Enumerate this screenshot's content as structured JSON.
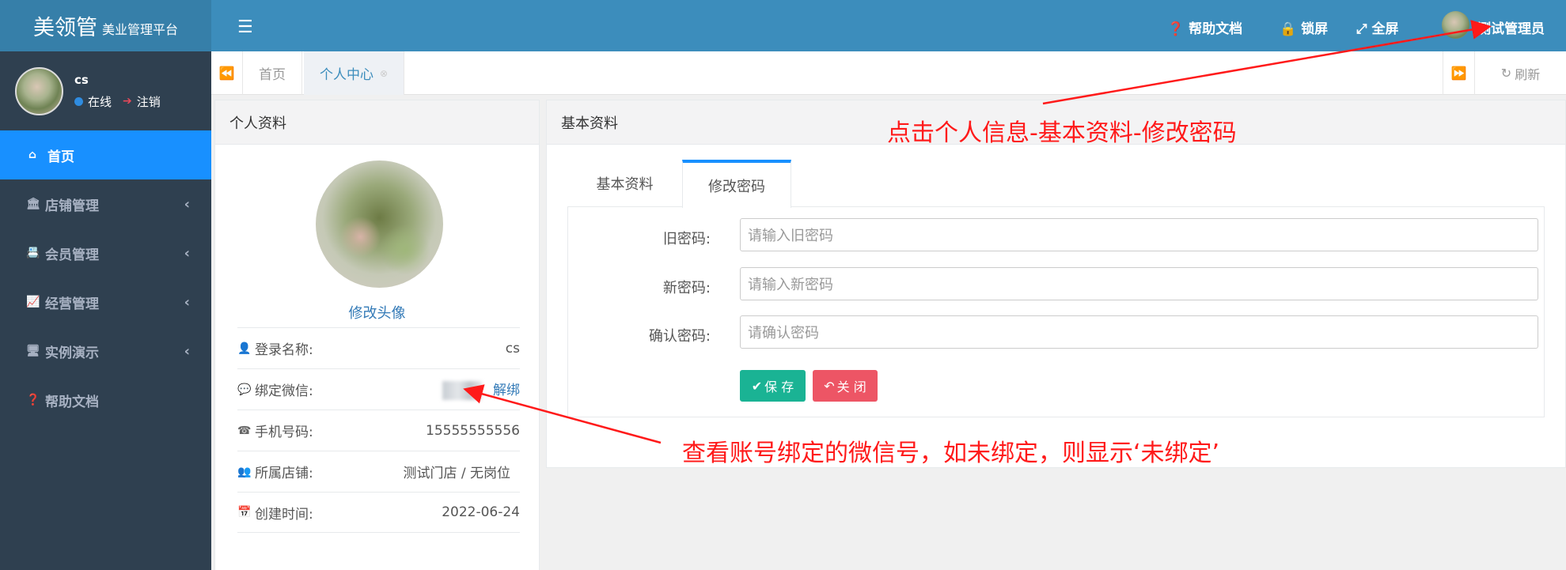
{
  "brand": {
    "name": "美领管",
    "subtitle": "美业管理平台"
  },
  "user_panel": {
    "name": "cs",
    "status": "在线",
    "logout": "注销"
  },
  "sidebar": {
    "items": [
      {
        "label": "首页",
        "icon": "home-icon"
      },
      {
        "label": "店铺管理",
        "icon": "bank-icon"
      },
      {
        "label": "会员管理",
        "icon": "id-card-icon"
      },
      {
        "label": "经营管理",
        "icon": "line-chart-icon"
      },
      {
        "label": "实例演示",
        "icon": "desktop-icon"
      },
      {
        "label": "帮助文档",
        "icon": "question-circle-icon"
      }
    ]
  },
  "topbar": {
    "help": "帮助文档",
    "lock": "锁屏",
    "fullscreen": "全屏",
    "admin": "测试管理员"
  },
  "tabs": {
    "home": "首页",
    "profile": "个人中心",
    "refresh": "刷新"
  },
  "left_panel": {
    "title": "个人资料",
    "change_avatar": "修改头像",
    "rows": [
      {
        "label": "登录名称:",
        "value": "cs",
        "icon": "user-icon"
      },
      {
        "label": "绑定微信:",
        "value": "解绑",
        "icon": "wechat-icon"
      },
      {
        "label": "手机号码:",
        "value": "15555555556",
        "icon": "phone-icon"
      },
      {
        "label": "所属店铺:",
        "value": "测试门店 / 无岗位",
        "icon": "users-icon"
      },
      {
        "label": "创建时间:",
        "value": "2022-06-24",
        "icon": "calendar-icon"
      }
    ]
  },
  "right_panel": {
    "title": "基本资料",
    "tab_basic": "基本资料",
    "tab_password": "修改密码",
    "old_password_label": "旧密码:",
    "old_password_placeholder": "请输入旧密码",
    "new_password_label": "新密码:",
    "new_password_placeholder": "请输入新密码",
    "confirm_password_label": "确认密码:",
    "confirm_password_placeholder": "请确认密码",
    "save": "保 存",
    "close": "关 闭"
  },
  "annotations": {
    "top": "点击个人信息-基本资料-修改密码",
    "bottom": "查看账号绑定的微信号，如未绑定，则显示‘未绑定’"
  },
  "colors": {
    "sidebar_bg": "#2f4050",
    "topbar_bg": "#3c8dbc",
    "active_blue": "#1890ff",
    "save_green": "#1ab394",
    "close_red": "#ed5565",
    "annotation_red": "#ff1a1a"
  }
}
